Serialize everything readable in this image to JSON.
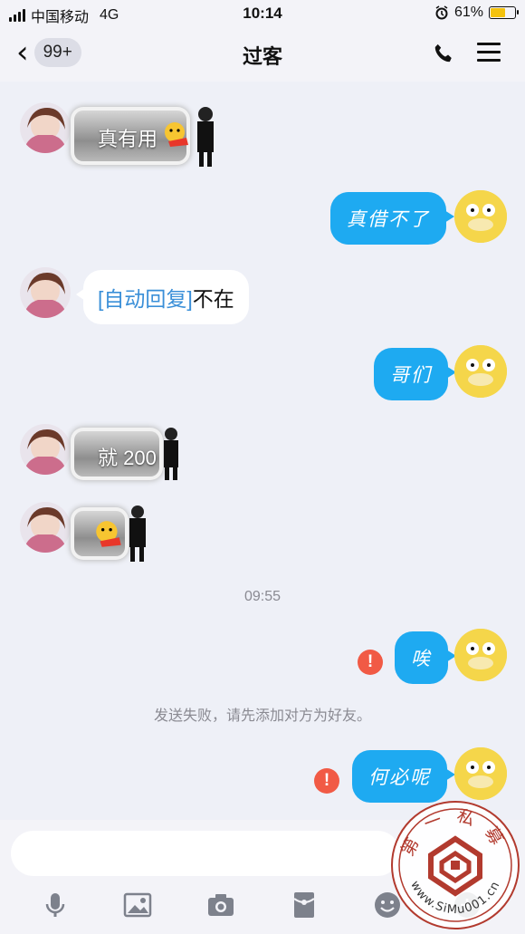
{
  "status_bar": {
    "carrier": "中国移动",
    "network": "4G",
    "time": "10:14",
    "battery_percent": 61,
    "battery_text": "61%"
  },
  "header": {
    "back_badge": "99+",
    "title": "过客"
  },
  "messages": {
    "m1_text": "真有用",
    "m2_text": "真借不了",
    "m3_tag": "[自动回复]",
    "m3_text": "不在",
    "m4_text": "哥们",
    "m5_text": "就 200",
    "time_label": "09:55",
    "m7_text": "唉",
    "system_notice": "发送失败，请先添加对方为好友。",
    "m8_text": "何必呢"
  },
  "input": {
    "placeholder": ""
  },
  "toolbar": [
    "mic-icon",
    "image-icon",
    "camera-icon",
    "red-packet-icon",
    "emoji-icon",
    "plus-icon"
  ],
  "watermark": {
    "text": "第一私募",
    "url": "www.SiMu001.cn"
  },
  "colors": {
    "outgoing_bubble": "#1eaaf1",
    "incoming_bubble": "#ffffff",
    "auto_reply_tag": "#3a8fd8",
    "failure": "#f15a45",
    "background": "#eef0f7"
  }
}
